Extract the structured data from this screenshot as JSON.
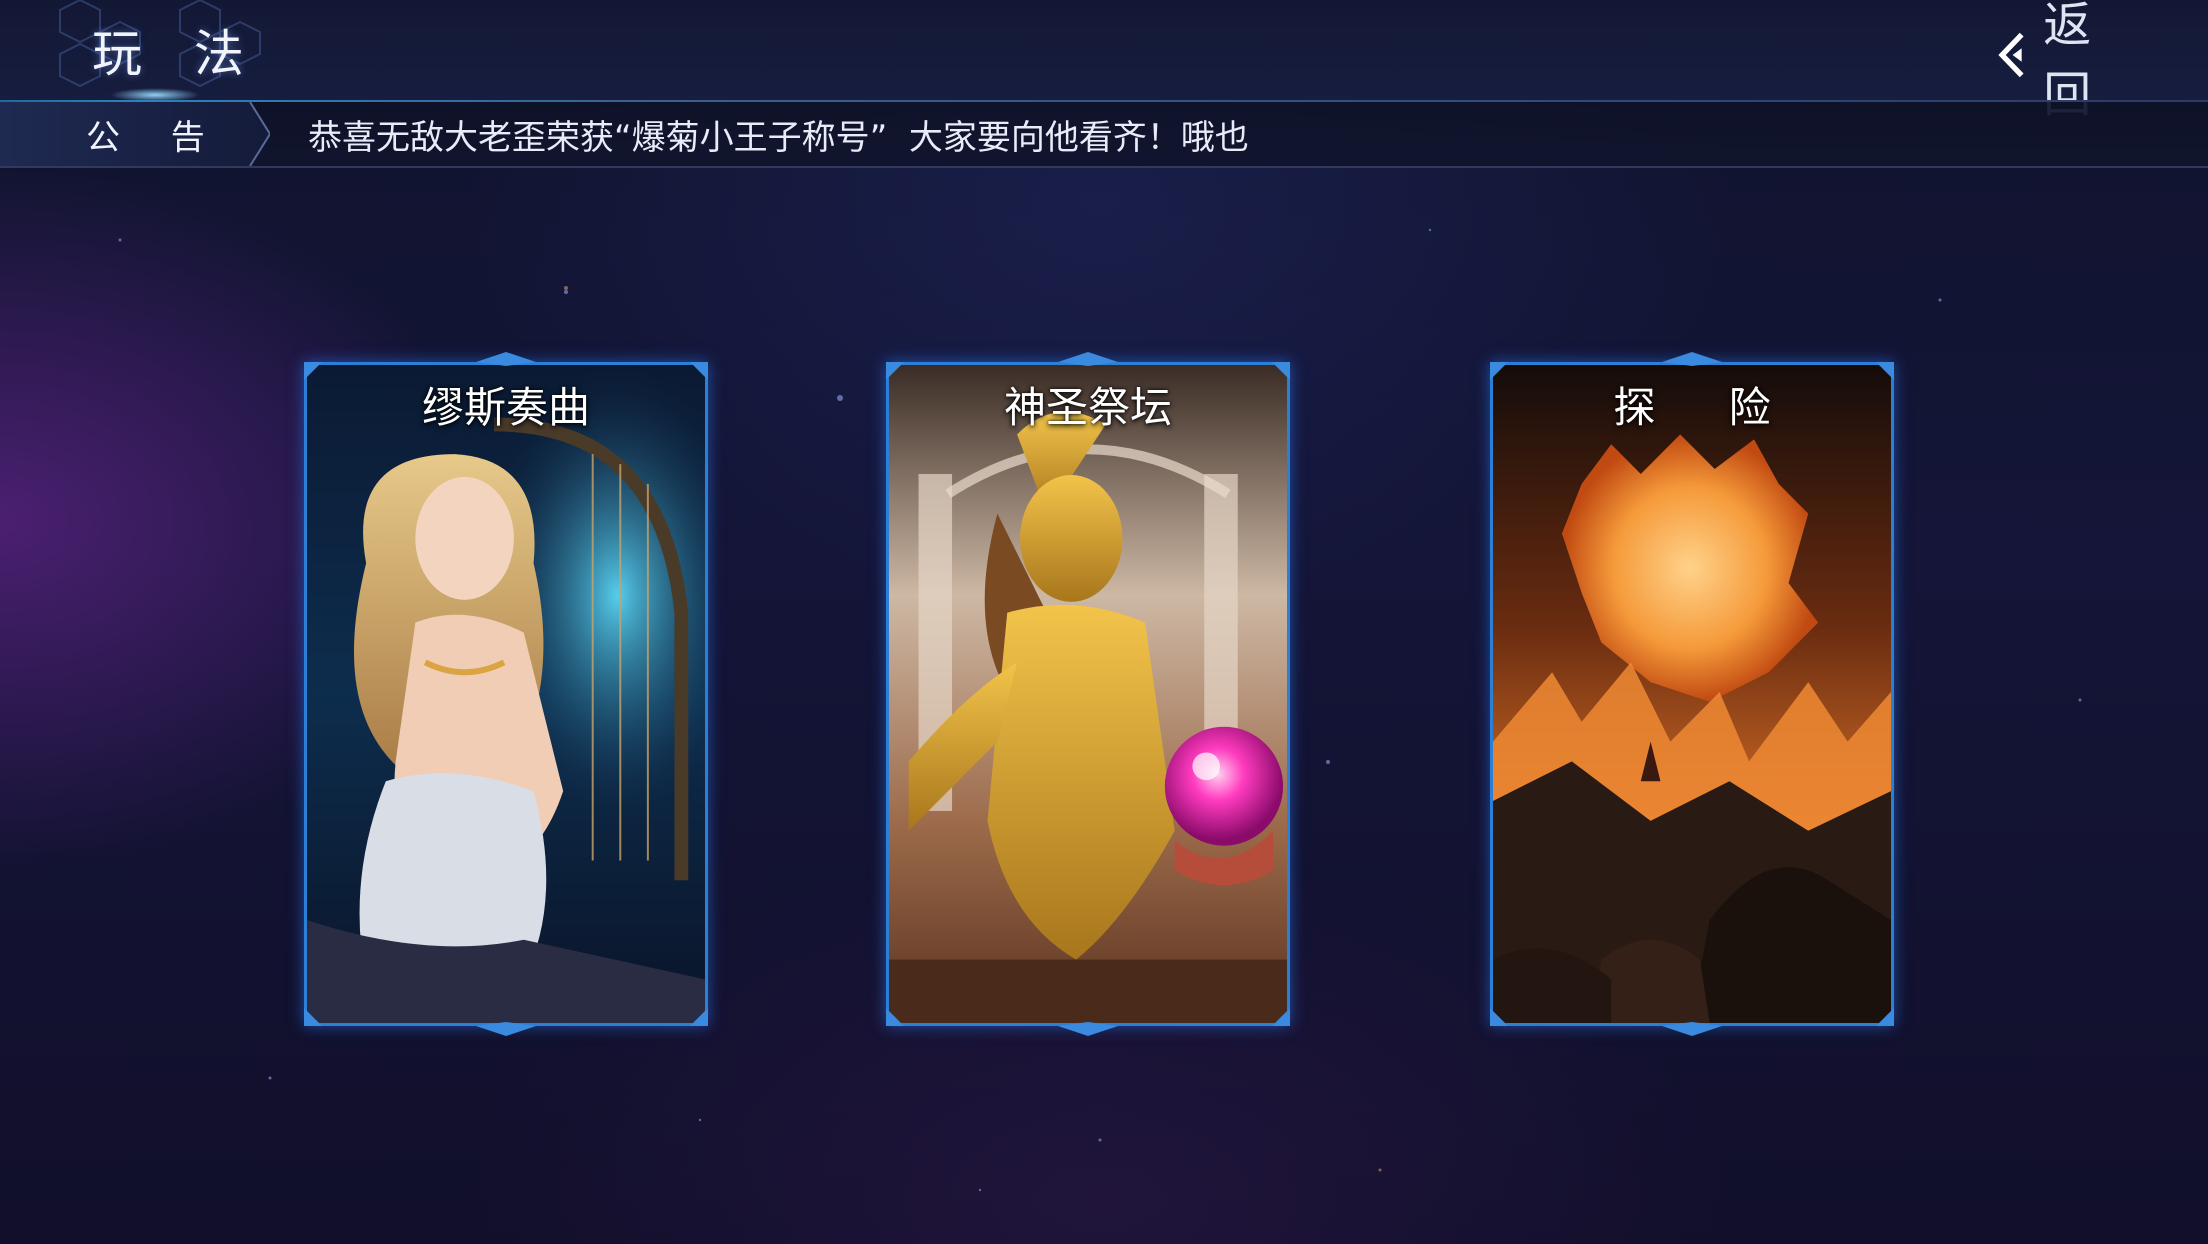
{
  "header": {
    "title": "玩 法",
    "back_label": "返 回"
  },
  "announcement": {
    "label": "公 告",
    "text": "恭喜无敌大老歪荣获“爆菊小王子称号”  大家要向他看齐！哦也"
  },
  "cards": [
    {
      "title": "缪斯奏曲",
      "art": "harp-muse-illustration"
    },
    {
      "title": "神圣祭坛",
      "art": "golden-goddess-orb-illustration"
    },
    {
      "title": "探 险",
      "art": "volcano-adventure-illustration"
    }
  ],
  "theme": {
    "frame_color": "#2b7fd6",
    "background": "#141538",
    "accent": "#7fd0ff"
  },
  "icons": {
    "back": "chevron-left-icon"
  }
}
